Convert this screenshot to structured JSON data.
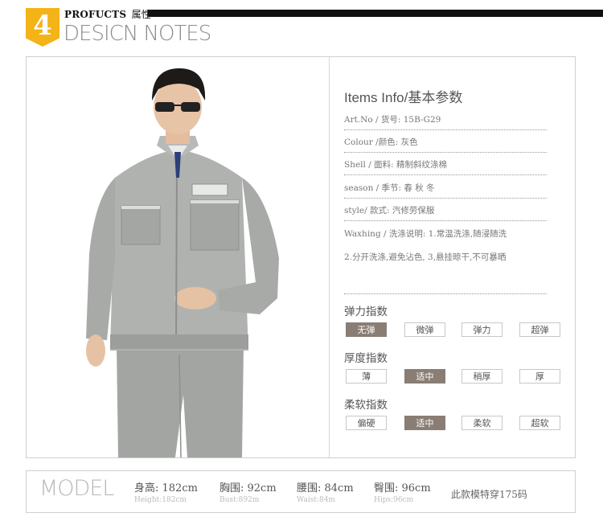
{
  "header": {
    "badge_number": "4",
    "product_label": "PROFUCTS",
    "attr_label": "属性",
    "design_notes": "DESICN NOTES"
  },
  "info": {
    "title": "Items Info/基本参数",
    "rows": [
      "Art.No / 货号: 15B-G29",
      "Colour /颜色: 灰色",
      "Shell / 面料: 精制斜纹涤棉",
      "season / 季节: 春 秋 冬",
      "style/ 款式: 汽修劳保服",
      "Waxhing / 洗涤说明: 1.常温洗涤,随浸随洗",
      "2.分开洗涤,避免沾色, 3,悬挂晾干,不可暴晒"
    ]
  },
  "indices": [
    {
      "title": "弹力指数",
      "options": [
        "无弹",
        "微弹",
        "弹力",
        "超弹"
      ],
      "selected": "无弹"
    },
    {
      "title": "厚度指数",
      "options": [
        "薄",
        "适中",
        "稍厚",
        "厚"
      ],
      "selected": "适中"
    },
    {
      "title": "柔软指数",
      "options": [
        "偏硬",
        "适中",
        "柔软",
        "超软"
      ],
      "selected": "适中"
    }
  ],
  "model": {
    "label": "MODEL",
    "height": "身高: 182cm",
    "height_en": "Height:182cm",
    "bust": "胸围: 92cm",
    "bust_en": "Bust:892m",
    "waist": "腰围: 84cm",
    "waist_en": "Waist:84m",
    "hips": "臀围: 96cm",
    "hips_en": "Hips:96cm",
    "note": "此款模特穿175码"
  },
  "colors": {
    "accent_badge": "#f4b316",
    "chip_selected": "#8a7d74",
    "jacket_grey": "#a9aba9"
  }
}
